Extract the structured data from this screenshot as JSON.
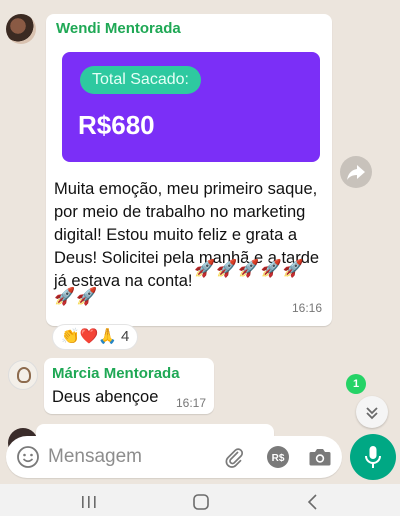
{
  "messages": [
    {
      "sender": "Wendi Mentorada",
      "card": {
        "label": "Total Sacado:",
        "amount": "R$680"
      },
      "text": "Muita emoção, meu primeiro saque, por meio de trabalho no marketing digital! Estou muito feliz e grata a Deus! Solicitei pela manhã e a tarde já estava na conta!",
      "rockets_line1": "🚀🚀🚀🚀🚀",
      "rockets_line2": "🚀🚀",
      "time": "16:16",
      "reactions": {
        "emojis": "👏❤️🙏",
        "count": "4"
      }
    },
    {
      "sender": "Márcia Mentorada",
      "text": "Deus abençoe",
      "time": "16:17"
    }
  ],
  "unread_badge": "1",
  "composer": {
    "placeholder": "Mensagem"
  },
  "colors": {
    "accent_green": "#00a884",
    "sender_green": "#1fa855",
    "card_purple": "#7b2ff7",
    "pill_teal": "#2ec9a0",
    "chat_background": "#ece5dd"
  },
  "icons": [
    "forward-icon",
    "chevron-down-icon",
    "emoji-icon",
    "attach-icon",
    "payment-icon",
    "camera-icon",
    "mic-icon",
    "recents-icon",
    "home-icon",
    "back-icon"
  ]
}
